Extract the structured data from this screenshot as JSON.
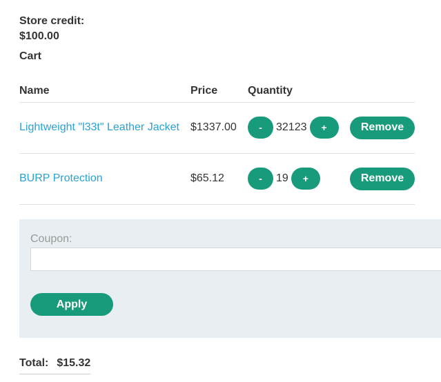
{
  "store_credit": {
    "label": "Store credit:",
    "value": "$100.00"
  },
  "cart_title": "Cart",
  "table": {
    "headers": {
      "name": "Name",
      "price": "Price",
      "quantity": "Quantity"
    },
    "rows": [
      {
        "name": "Lightweight \"l33t\" Leather Jacket",
        "price": "$1337.00",
        "quantity": "32123",
        "minus": "-",
        "plus": "+",
        "remove": "Remove"
      },
      {
        "name": "BURP Protection",
        "price": "$65.12",
        "quantity": "19",
        "minus": "-",
        "plus": "+",
        "remove": "Remove"
      }
    ]
  },
  "coupon": {
    "label": "Coupon:",
    "value": "",
    "apply_label": "Apply"
  },
  "total": {
    "label": "Total:",
    "value": "$15.32"
  },
  "colors": {
    "accent": "#189b7b",
    "link": "#29a3d1",
    "panel": "#e8eef1"
  }
}
